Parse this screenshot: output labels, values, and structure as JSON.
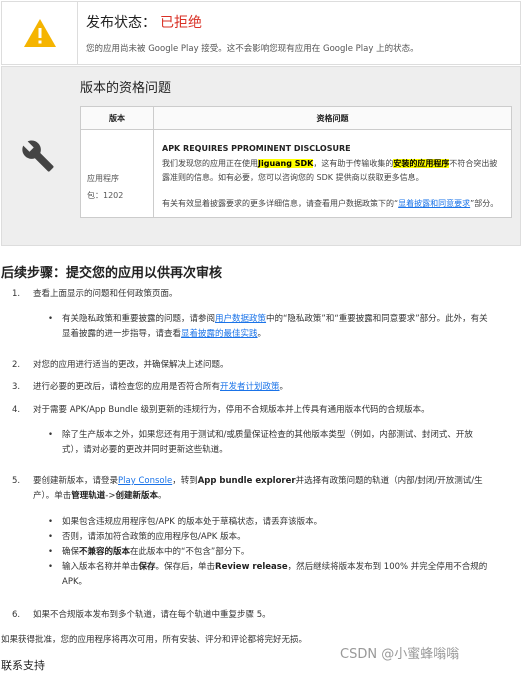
{
  "status": {
    "label": "发布状态：",
    "value": "已拒绝",
    "description": "您的应用尚未被 Google Play 接受。这不会影响您现有应用在 Google Play 上的状态。"
  },
  "qualification": {
    "title": "版本的资格问题",
    "columns": [
      "版本",
      "资格问题"
    ],
    "row": {
      "app_line1": "应用程序",
      "app_line2": "包：1202",
      "issue_heading": "APK REQUIRES PPROMINENT DISCLOSURE",
      "issue_p1": "我们发现您的应用正在使用",
      "issue_sdk": "Jiguang SDK",
      "issue_p2": "，这有助于传输收集的",
      "issue_hl2": "安装的应用程序",
      "issue_p3": "不符合突出披露准则的信息。如有必要，您可以咨询您的 SDK 提供商以获取更多信息。",
      "more_p1": "有关有效显着披露要求的更多详细信息，请查看用户数据政策下的“",
      "more_link": "显着披露和同意要求",
      "more_p2": "”部分。"
    }
  },
  "steps": {
    "title": "后续步骤：提交您的应用以供再次审核",
    "s1": "查看上面显示的问题和任何政策页面。",
    "s1a_p1": "有关隐私政策和重要披露的问题，请参阅",
    "s1a_link1": "用户数据政策",
    "s1a_p2": "中的“隐私政策”和“重要披露和同意要求”部分。此外，有关显着披露的进一步指导，请查看",
    "s1a_link2": "显着披露的最佳实践",
    "s1a_p3": "。",
    "s2": "对您的应用进行适当的更改，并确保解决上述问题。",
    "s3_p1": "进行必要的更改后，请检查您的应用是否符合所有",
    "s3_link": "开发者计划政策",
    "s3_p2": "。",
    "s4": "对于需要 APK/App Bundle 级别更新的违规行为，停用不合规版本并上传具有通用版本代码的合规版本。",
    "s4a": "除了生产版本之外，如果您还有用于测试和/或质量保证检查的其他版本类型（例如，内部测试、封闭式、开放式），请对必要的更改并同时更新这些轨道。",
    "s5_p1": "要创建新版本，请登录",
    "s5_link": "Play Console",
    "s5_p2": "，转到",
    "s5_b1": "App bundle explorer",
    "s5_p3": "并选择有政策问题的轨道（内部/封闭/开放测试/生产）。单击",
    "s5_b2": "管理轨道",
    "s5_p4": "->",
    "s5_b3": "创建新版本",
    "s5_p5": "。",
    "s5a": "如果包含违规应用程序包/APK 的版本处于草稿状态，请丢弃该版本。",
    "s5b": "否则，请添加符合政策的应用程序包/APK 版本。",
    "s5c_p1": "确保",
    "s5c_b": "不兼容的版本",
    "s5c_p2": "在此版本中的“不包含”部分下。",
    "s5d_p1": "输入版本名称并单击",
    "s5d_b1": "保存",
    "s5d_p2": "。保存后，单击",
    "s5d_b2": "Review release",
    "s5d_p3": "，然后继续将版本发布到 100% 并完全停用不合规的 APK。",
    "s6": "如果不合规版本发布到多个轨道，请在每个轨道中重复步骤 5。",
    "numbers": [
      "1.",
      "2.",
      "3.",
      "4.",
      "5.",
      "6."
    ],
    "bullet": "•"
  },
  "final": "如果获得批准，您的应用程序将再次可用，所有安装、评分和评论都将完好无损。",
  "contact": "联系支持",
  "watermark": "CSDN @小蜜蜂嗡嗡"
}
